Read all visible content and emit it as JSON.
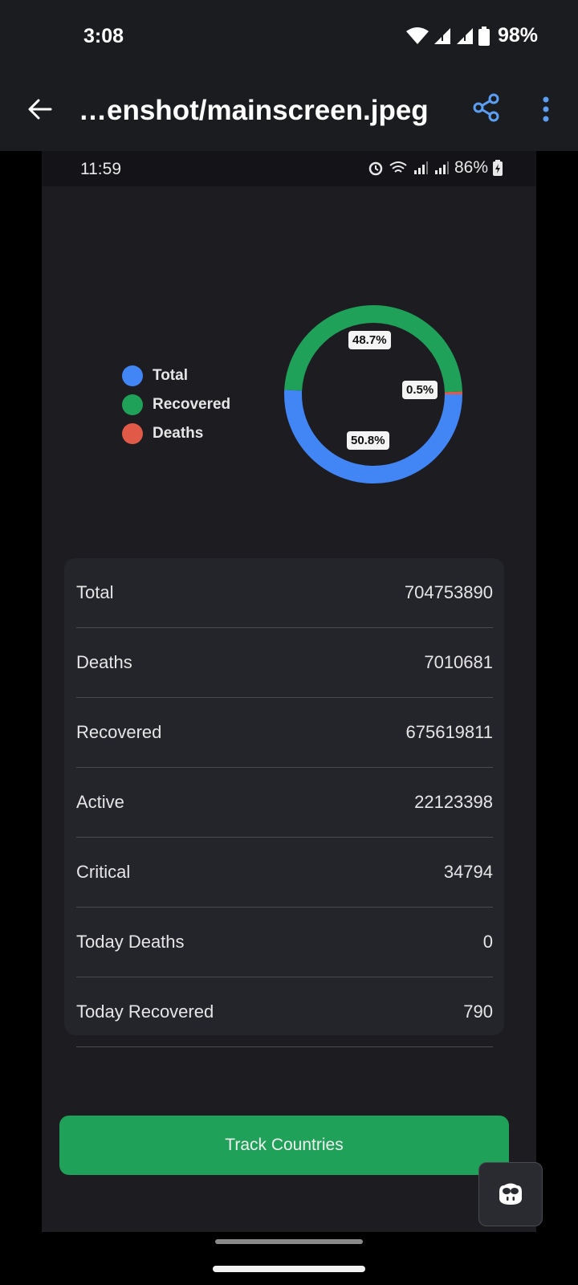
{
  "os_status": {
    "time": "3:08",
    "battery": "98%"
  },
  "appbar": {
    "title": "…enshot/mainscreen.jpeg"
  },
  "inner_status": {
    "time": "11:59",
    "battery": "86%"
  },
  "legend": [
    {
      "label": "Total",
      "color": "#4285f4"
    },
    {
      "label": "Recovered",
      "color": "#1fa15a"
    },
    {
      "label": "Deaths",
      "color": "#e05a47"
    }
  ],
  "chart_data": {
    "type": "pie",
    "series": [
      {
        "name": "Total",
        "value": 50.8,
        "label": "50.8%",
        "color": "#4285f4"
      },
      {
        "name": "Recovered",
        "value": 48.7,
        "label": "48.7%",
        "color": "#1fa15a"
      },
      {
        "name": "Deaths",
        "value": 0.5,
        "label": "0.5%",
        "color": "#e05a47"
      }
    ]
  },
  "stats": [
    {
      "label": "Total",
      "value": "704753890"
    },
    {
      "label": "Deaths",
      "value": "7010681"
    },
    {
      "label": "Recovered",
      "value": "675619811"
    },
    {
      "label": "Active",
      "value": "22123398"
    },
    {
      "label": "Critical",
      "value": "34794"
    },
    {
      "label": "Today Deaths",
      "value": "0"
    },
    {
      "label": "Today Recovered",
      "value": "790"
    }
  ],
  "track_button": {
    "label": "Track Countries"
  },
  "icons": {
    "back": "arrow-left-icon",
    "share": "share-icon",
    "more": "more-vert-icon",
    "assistant": "assistant-icon"
  }
}
